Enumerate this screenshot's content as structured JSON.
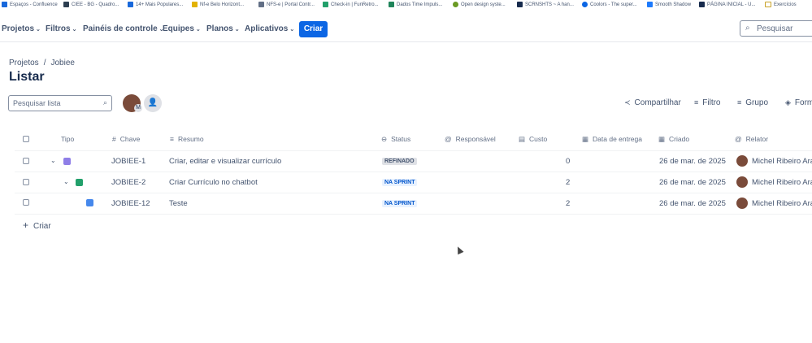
{
  "bookmarks": [
    {
      "label": "Espaços - Confluence",
      "color": "#1868db"
    },
    {
      "label": "CIEE - BG - Quadro...",
      "color": "#2c3e50"
    },
    {
      "label": "14+ Mais Populares...",
      "color": "#1868db"
    },
    {
      "label": "Nf-e Belo Horizont...",
      "color": "#e2b203"
    },
    {
      "label": "NFS-e | Portal Contr...",
      "color": "#626f86"
    },
    {
      "label": "Check-in | FunRetro...",
      "color": "#22a06b"
    },
    {
      "label": "Dados Time Impuls...",
      "color": "#1f845a"
    },
    {
      "label": "Open design syste...",
      "color": "#6a9a23"
    },
    {
      "label": "SCRNSHTS ~ A han...",
      "color": "#172b4d"
    },
    {
      "label": "Coolors - The super...",
      "color": "#0c66e4"
    },
    {
      "label": "Smooth Shadow",
      "color": "#1d7afc"
    },
    {
      "label": "PÁGINA INICIAL - U...",
      "color": "#172b4d"
    },
    {
      "label": "Exercícios",
      "color": "#c9a227"
    }
  ],
  "nav": {
    "projetos": "Projetos",
    "filtros": "Filtros",
    "paineis": "Painéis de controle",
    "equipes": "Equipes",
    "planos": "Planos",
    "aplicativos": "Aplicativos",
    "criar": "Criar",
    "search_placeholder": "Pesquisar"
  },
  "breadcrumb": {
    "root": "Projetos",
    "project": "Jobiee"
  },
  "page_title": "Listar",
  "list_search_placeholder": "Pesquisar lista",
  "avatar_badge": "M",
  "toolbar": {
    "share": "Compartilhar",
    "filter": "Filtro",
    "group": "Grupo",
    "format": "Formatar"
  },
  "columns": {
    "type": "Tipo",
    "key": "Chave",
    "summary": "Resumo",
    "status": "Status",
    "assignee": "Responsável",
    "cost": "Custo",
    "due": "Data de entrega",
    "created": "Criado",
    "reporter": "Relator"
  },
  "rows": [
    {
      "key": "JOBIEE-1",
      "summary": "Criar, editar e visualizar currículo",
      "status": "REFINADO",
      "cost": "0",
      "created": "26 de mar. de 2025",
      "reporter": "Michel Ribeiro Araújo",
      "type_color": "#8f7ee7"
    },
    {
      "key": "JOBIEE-2",
      "summary": "Criar Currículo no chatbot",
      "status": "NA SPRINT",
      "cost": "2",
      "created": "26 de mar. de 2025",
      "reporter": "Michel Ribeiro Araújo",
      "type_color": "#22a06b"
    },
    {
      "key": "JOBIEE-12",
      "summary": "Teste",
      "status": "NA SPRINT",
      "cost": "2",
      "created": "26 de mar. de 2025",
      "reporter": "Michel Ribeiro Araújo",
      "type_color": "#4688ec"
    }
  ],
  "create_row": "Criar",
  "colors": {
    "primary": "#0c66e4",
    "status_refinado_bg": "#dfe1e6",
    "status_sprint_bg": "#e9f2ff"
  }
}
